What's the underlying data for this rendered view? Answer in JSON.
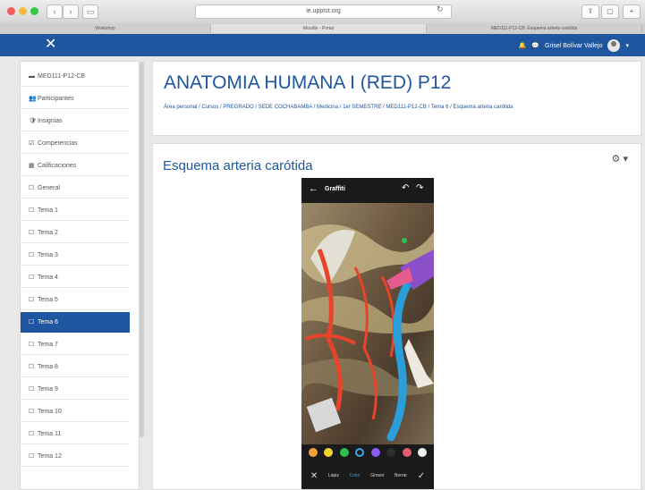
{
  "browser": {
    "url": "ie.upptst.org",
    "tabs": [
      "Workshop",
      "Moodle - Portal",
      "MED111-P12-CB: Esquema arteria carótida"
    ],
    "nav_back": "‹",
    "nav_forward": "›",
    "reload": "↻",
    "share": "⇪",
    "new_tab": "+"
  },
  "navbar": {
    "close_icon": "✕",
    "user_name": "Grisel Bolívar Vallejo",
    "user_caret": "▾"
  },
  "sidebar": {
    "items": [
      {
        "icon": "▬",
        "label": "MED111-P12-CB"
      },
      {
        "icon": "👥",
        "label": "Participantes"
      },
      {
        "icon": "🛡",
        "label": "Insignias"
      },
      {
        "icon": "☑",
        "label": "Competencias"
      },
      {
        "icon": "▦",
        "label": "Calificaciones"
      },
      {
        "icon": "☐",
        "label": "General"
      },
      {
        "icon": "☐",
        "label": "Tema 1"
      },
      {
        "icon": "☐",
        "label": "Tema 2"
      },
      {
        "icon": "☐",
        "label": "Tema 3"
      },
      {
        "icon": "☐",
        "label": "Tema 4"
      },
      {
        "icon": "☐",
        "label": "Tema 5"
      },
      {
        "icon": "☐",
        "label": "Tema 6"
      },
      {
        "icon": "☐",
        "label": "Tema 7"
      },
      {
        "icon": "☐",
        "label": "Tema 8"
      },
      {
        "icon": "☐",
        "label": "Tema 9"
      },
      {
        "icon": "☐",
        "label": "Tema 10"
      },
      {
        "icon": "☐",
        "label": "Tema 11"
      },
      {
        "icon": "☐",
        "label": "Tema 12"
      }
    ],
    "active_index": 11
  },
  "header": {
    "title": "ANATOMIA HUMANA I (RED) P12",
    "breadcrumb": "Área personal / Cursos / PREGRADO / SEDE COCHABAMBA / Medicina / 1er SEMESTRE / MED111-P12-CB / Tema 6 / Esquema arteria carótida"
  },
  "content": {
    "title": "Esquema arteria carótida",
    "gear": "⚙ ▾"
  },
  "phone": {
    "back": "←",
    "app_title": "Graffiti",
    "undo": "↶",
    "redo": "↷",
    "palette": [
      "#f2a03a",
      "#f2d22e",
      "#2ebd4f",
      "#38a6e8",
      "#8b5cf6",
      "#2d2d2d",
      "#e25c6e",
      "#f0f0f0"
    ],
    "tools": [
      "✕",
      "Lápiz",
      "Color",
      "Grosor",
      "Borrar",
      "✓"
    ]
  },
  "colors": {
    "brand": "#1e56a0",
    "sidebar_active": "#1e56a0"
  }
}
